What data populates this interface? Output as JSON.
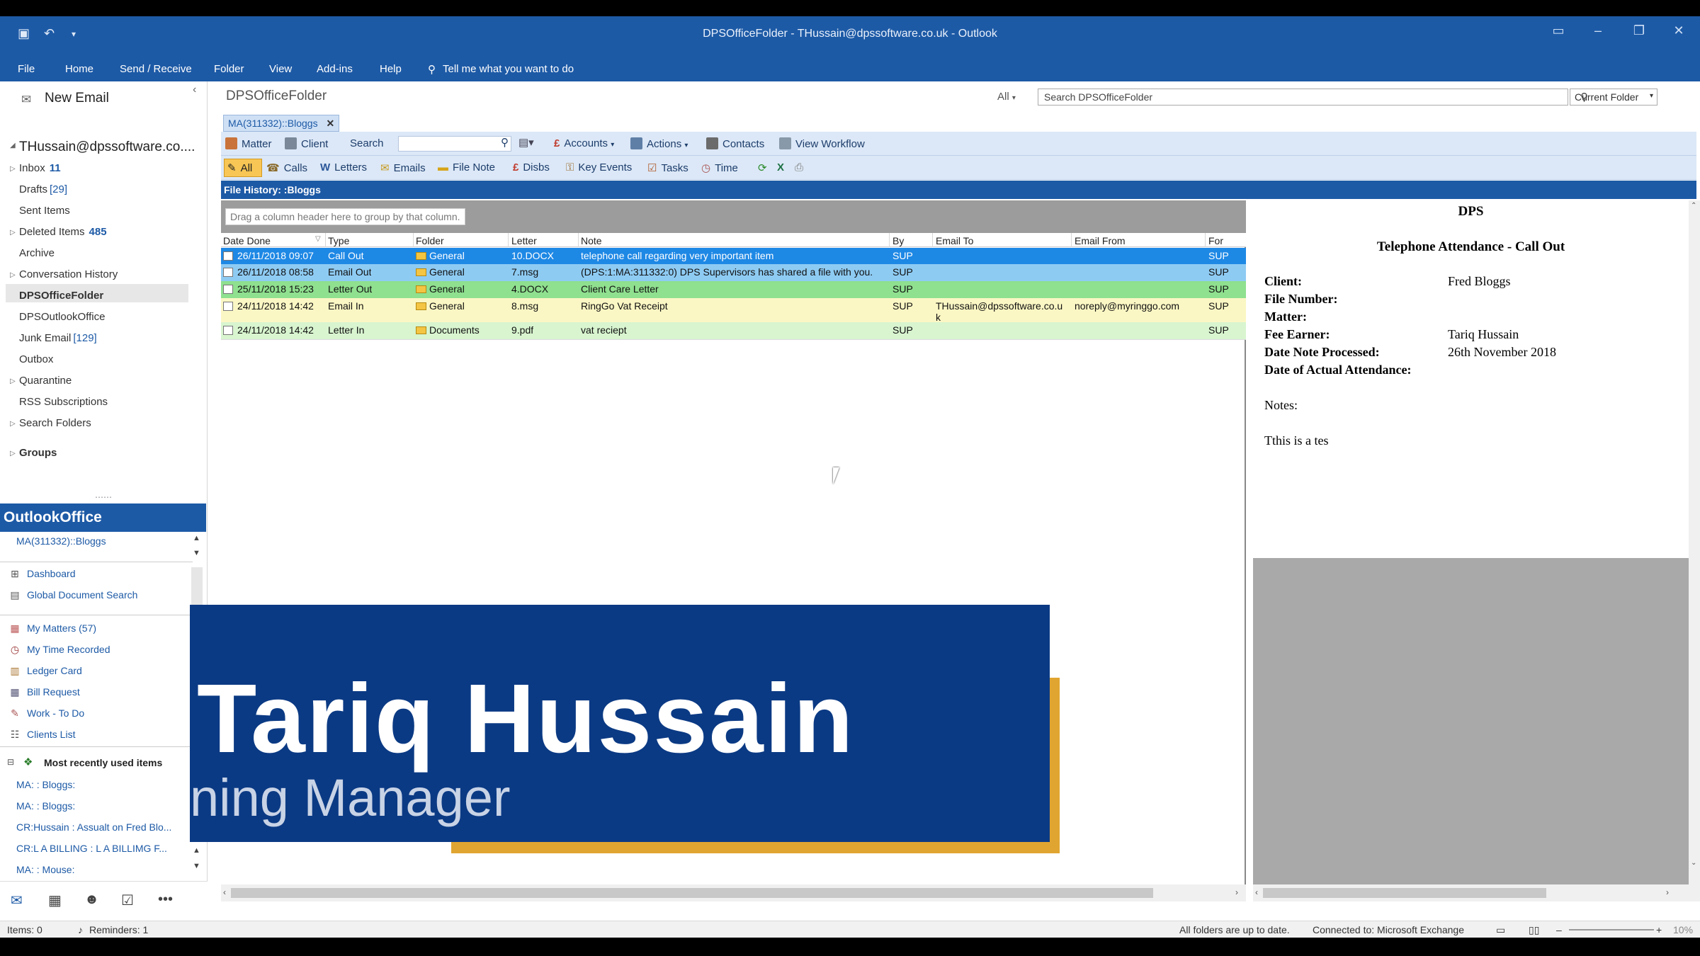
{
  "window": {
    "title": "DPSOfficeFolder - THussain@dpssoftware.co.uk  -  Outlook"
  },
  "ribbon": {
    "tabs": [
      "File",
      "Home",
      "Send / Receive",
      "Folder",
      "View",
      "Add-ins",
      "Help"
    ],
    "tell_me": "Tell me what you want to do"
  },
  "nav": {
    "new_email": "New Email",
    "account": "THussain@dpssoftware.co....",
    "folders": [
      {
        "label": "Inbox",
        "count": "11",
        "style": "bold"
      },
      {
        "label": "Drafts",
        "count": "[29]",
        "style": "bracket"
      },
      {
        "label": "Sent Items",
        "count": ""
      },
      {
        "label": "Deleted Items",
        "count": "485",
        "style": "bold"
      },
      {
        "label": "Archive",
        "count": ""
      },
      {
        "label": "Conversation History",
        "count": ""
      },
      {
        "label": "DPSOfficeFolder",
        "count": ""
      },
      {
        "label": "DPSOutlookOffice",
        "count": ""
      },
      {
        "label": "Junk Email",
        "count": "[129]",
        "style": "bracket"
      },
      {
        "label": "Outbox",
        "count": ""
      },
      {
        "label": "Quarantine",
        "count": ""
      },
      {
        "label": "RSS Subscriptions",
        "count": ""
      },
      {
        "label": "Search Folders",
        "count": ""
      }
    ],
    "groups": "Groups"
  },
  "outlookoffice": {
    "title": "OutlookOffice",
    "current": "MA(311332)::Bloggs",
    "items": [
      "Dashboard",
      "Global Document Search",
      "My Matters (57)",
      "My Time Recorded",
      "Ledger Card",
      "Bill Request",
      "Work - To Do",
      "Clients List"
    ],
    "recent_title": "Most recently used items",
    "recent": [
      "MA: : Bloggs:",
      "MA: : Bloggs:",
      "CR:Hussain : Assualt on Fred Blo...",
      "CR:L A BILLING : L A BILLIMG F...",
      "MA: : Mouse:"
    ]
  },
  "main": {
    "folder_title": "DPSOfficeFolder",
    "scope": "All",
    "search_placeholder": "Search DPSOfficeFolder",
    "current_folder": "Current Folder",
    "matter_tab": "MA(311332)::Bloggs",
    "toolbar1": [
      "Matter",
      "Client",
      "Search",
      "Accounts",
      "Actions",
      "Contacts",
      "View Workflow"
    ],
    "toolbar2": [
      "All",
      "Calls",
      "Letters",
      "Emails",
      "File Note",
      "Disbs",
      "Key Events",
      "Tasks",
      "Time"
    ],
    "file_history": "File History: :Bloggs",
    "group_hint": "Drag a column header here to group by that column.",
    "columns": [
      "Date Done",
      "Type",
      "Folder",
      "Letter",
      "Note",
      "By",
      "Email To",
      "Email From",
      "For"
    ],
    "rows": [
      {
        "date": "26/11/2018 09:07",
        "type": "Call Out",
        "folder": "General",
        "letter": "10.DOCX",
        "note": "telephone call regarding very important item",
        "by": "SUP",
        "to": "",
        "from": "",
        "for": "SUP",
        "bg": "#1e88e5",
        "fg": "#ffffff"
      },
      {
        "date": "26/11/2018 08:58",
        "type": "Email Out",
        "folder": "General",
        "letter": "7.msg",
        "note": "(DPS:1:MA:311332:0) DPS  Supervisors has shared a file with you.",
        "by": "SUP",
        "to": "",
        "from": "",
        "for": "SUP",
        "bg": "#8ecbf3",
        "fg": "#111111"
      },
      {
        "date": "25/11/2018 15:23",
        "type": "Letter Out",
        "folder": "General",
        "letter": "4.DOCX",
        "note": "Client Care Letter",
        "by": "SUP",
        "to": "",
        "from": "",
        "for": "SUP",
        "bg": "#8fe08f",
        "fg": "#111111"
      },
      {
        "date": "24/11/2018 14:42",
        "type": "Email In",
        "folder": "General",
        "letter": "8.msg",
        "note": "RingGo Vat Receipt",
        "by": "SUP",
        "to": "THussain@dpssoftware.co.uk",
        "from": "noreply@myringgo.com",
        "for": "SUP",
        "bg": "#fbf7c4",
        "fg": "#111111"
      },
      {
        "date": "24/11/2018 14:42",
        "type": "Letter In",
        "folder": "Documents",
        "letter": "9.pdf",
        "note": "vat reciept",
        "by": "SUP",
        "to": "",
        "from": "",
        "for": "SUP",
        "bg": "#d8f5cf",
        "fg": "#111111"
      }
    ]
  },
  "preview": {
    "heading": "DPS",
    "subheading": "Telephone Attendance - Call Out",
    "fields": [
      {
        "label": "Client:",
        "value": "Fred Bloggs"
      },
      {
        "label": "File Number:",
        "value": ""
      },
      {
        "label": "Matter:",
        "value": ""
      },
      {
        "label": "Fee Earner:",
        "value": "Tariq Hussain"
      },
      {
        "label": "Date Note Processed:",
        "value": "26th November 2018"
      },
      {
        "label": "Date of Actual Attendance:",
        "value": ""
      }
    ],
    "notes_label": "Notes:",
    "notes": "Tthis is a tes"
  },
  "status": {
    "items": "Items: 0",
    "reminders": "Reminders: 1",
    "sync": "All folders are up to date.",
    "connection": "Connected to: Microsoft Exchange",
    "zoom": "10%"
  },
  "banner": {
    "name": "Tariq Hussain",
    "role": "ning Manager"
  },
  "colors": {
    "accent": "#1d5aa6",
    "banner_blue": "#0b3a84",
    "banner_gold": "#e0a531"
  }
}
